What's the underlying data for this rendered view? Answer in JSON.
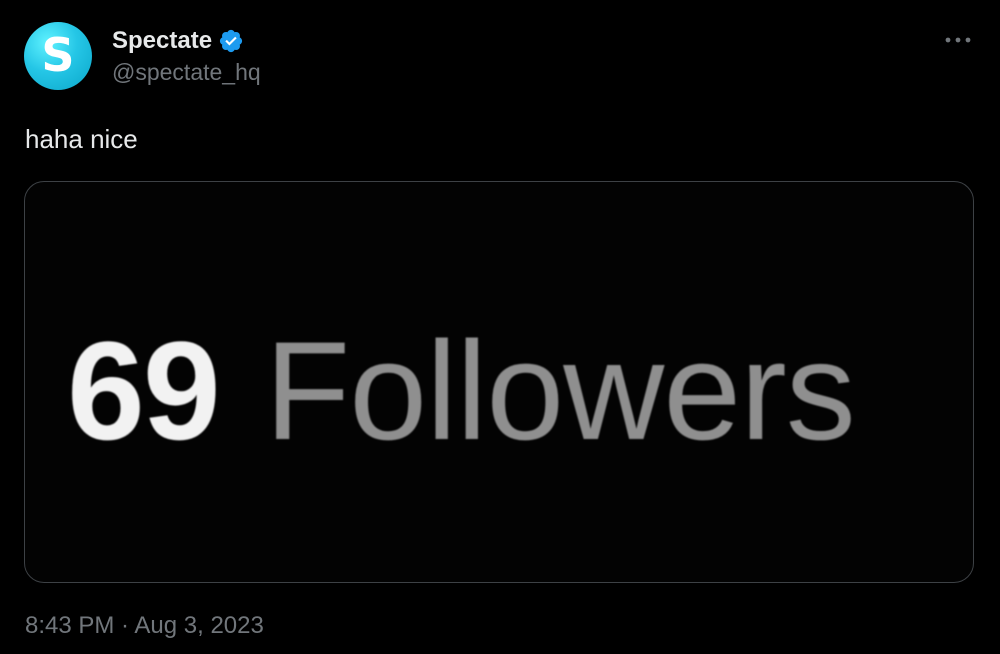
{
  "author": {
    "avatar_letter": "S",
    "display_name": "Spectate",
    "handle": "@spectate_hq",
    "verified": true
  },
  "tweet": {
    "text": "haha nice",
    "timestamp": "8:43 PM · Aug 3, 2023"
  },
  "media": {
    "count": "69",
    "label": "Followers"
  },
  "colors": {
    "background": "#000000",
    "text_primary": "#e7e9ea",
    "text_secondary": "#71767b",
    "verified_blue": "#1d9bf0",
    "avatar_cyan": "#25c6e6",
    "card_border": "#3d4145"
  },
  "icons": {
    "verified": "verified-badge-icon",
    "more": "more-horizontal-icon"
  }
}
